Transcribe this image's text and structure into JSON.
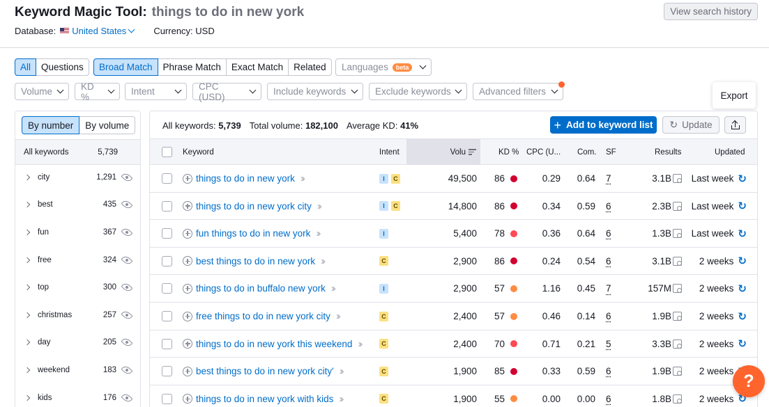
{
  "header": {
    "title": "Keyword Magic Tool:",
    "query": "things to do in new york",
    "history_button": "View search history",
    "database_label": "Database:",
    "database_value": "United States",
    "currency_label": "Currency: USD"
  },
  "filters": {
    "type_tabs": [
      "All",
      "Questions"
    ],
    "match_tabs": [
      "Broad Match",
      "Phrase Match",
      "Exact Match",
      "Related"
    ],
    "languages": "Languages",
    "beta": "beta",
    "dropdowns": [
      "Volume",
      "KD %",
      "Intent",
      "CPC (USD)",
      "Include keywords",
      "Exclude keywords",
      "Advanced filters"
    ]
  },
  "left_panel": {
    "toggle": [
      "By number",
      "By volume"
    ],
    "head_label": "All keywords",
    "head_count": "5,739",
    "items": [
      {
        "name": "city",
        "count": "1,291"
      },
      {
        "name": "best",
        "count": "435"
      },
      {
        "name": "fun",
        "count": "367"
      },
      {
        "name": "free",
        "count": "324"
      },
      {
        "name": "top",
        "count": "300"
      },
      {
        "name": "christmas",
        "count": "257"
      },
      {
        "name": "day",
        "count": "205"
      },
      {
        "name": "weekend",
        "count": "183"
      },
      {
        "name": "kids",
        "count": "176"
      }
    ]
  },
  "summary": {
    "all_keywords_label": "All keywords:",
    "all_keywords_value": "5,739",
    "total_volume_label": "Total volume:",
    "total_volume_value": "182,100",
    "avg_kd_label": "Average KD:",
    "avg_kd_value": "41%"
  },
  "actions": {
    "add_to_list": "Add to keyword list",
    "update": "Update",
    "export_tooltip": "Export"
  },
  "columns": [
    "Keyword",
    "Intent",
    "Volu",
    "KD %",
    "CPC (U...",
    "Com.",
    "SF",
    "Results",
    "Updated"
  ],
  "colors": {
    "accent": "#006dca",
    "kd_high": "#d1002f",
    "kd_mid": "#ff4953",
    "kd_low": "#ff8c43",
    "help": "#ff642d"
  },
  "rows": [
    {
      "keyword": "things to do in new york",
      "intent": [
        "I",
        "C"
      ],
      "volume": "49,500",
      "kd": "86",
      "kd_color": "#d1002f",
      "cpc": "0.29",
      "com": "0.64",
      "sf": "7",
      "results": "3.1B",
      "updated": "Last week"
    },
    {
      "keyword": "things to do in new york city",
      "intent": [
        "I",
        "C"
      ],
      "volume": "14,800",
      "kd": "86",
      "kd_color": "#d1002f",
      "cpc": "0.34",
      "com": "0.59",
      "sf": "6",
      "results": "2.3B",
      "updated": "Last week"
    },
    {
      "keyword": "fun things to do in new york",
      "intent": [
        "I"
      ],
      "volume": "5,400",
      "kd": "78",
      "kd_color": "#ff4953",
      "cpc": "0.36",
      "com": "0.64",
      "sf": "6",
      "results": "1.3B",
      "updated": "Last week"
    },
    {
      "keyword": "best things to do in new york",
      "intent": [
        "C"
      ],
      "volume": "2,900",
      "kd": "86",
      "kd_color": "#d1002f",
      "cpc": "0.24",
      "com": "0.54",
      "sf": "6",
      "results": "3.1B",
      "updated": "2 weeks"
    },
    {
      "keyword": "things to do in buffalo new york",
      "intent": [
        "I"
      ],
      "volume": "2,900",
      "kd": "57",
      "kd_color": "#ff8c43",
      "cpc": "1.16",
      "com": "0.45",
      "sf": "7",
      "results": "157M",
      "updated": "2 weeks"
    },
    {
      "keyword": "free things to do in new york city",
      "intent": [
        "C"
      ],
      "volume": "2,400",
      "kd": "57",
      "kd_color": "#ff8c43",
      "cpc": "0.46",
      "com": "0.14",
      "sf": "6",
      "results": "1.9B",
      "updated": "2 weeks"
    },
    {
      "keyword": "things to do in new york this weekend",
      "intent": [
        "C"
      ],
      "volume": "2,400",
      "kd": "70",
      "kd_color": "#ff4953",
      "cpc": "0.71",
      "com": "0.21",
      "sf": "5",
      "results": "3.3B",
      "updated": "2 weeks"
    },
    {
      "keyword": "best things to do in new york city'",
      "intent": [
        "C"
      ],
      "volume": "1,900",
      "kd": "85",
      "kd_color": "#d1002f",
      "cpc": "0.33",
      "com": "0.59",
      "sf": "6",
      "results": "1.9B",
      "updated": "2 weeks"
    },
    {
      "keyword": "things to do in new york with kids",
      "intent": [
        "C"
      ],
      "volume": "1,900",
      "kd": "55",
      "kd_color": "#ff8c43",
      "cpc": "0.00",
      "com": "0.00",
      "sf": "6",
      "results": "1.8B",
      "updated": "2 weeks"
    }
  ],
  "help_label": "?"
}
